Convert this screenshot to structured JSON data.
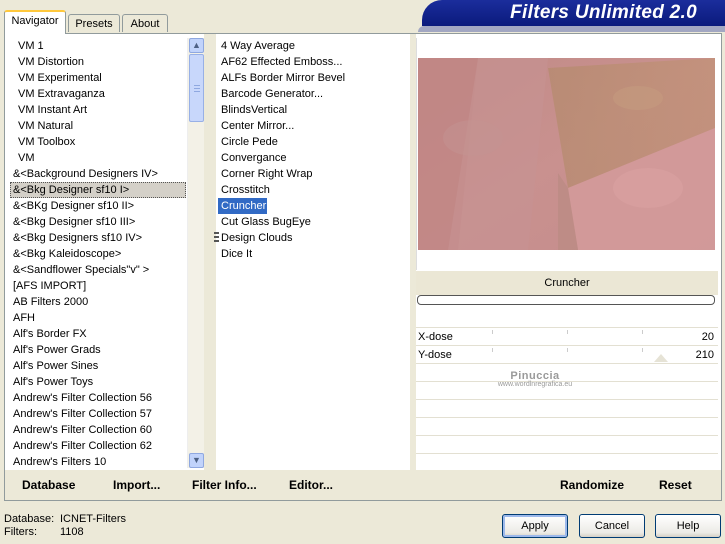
{
  "tabs": [
    {
      "label": "Navigator",
      "active": true
    },
    {
      "label": "Presets",
      "active": false
    },
    {
      "label": "About",
      "active": false
    }
  ],
  "banner_title": "Filters Unlimited 2.0",
  "categories": [
    "VM 1",
    "VM Distortion",
    "VM Experimental",
    "VM Extravaganza",
    "VM Instant Art",
    "VM Natural",
    "VM Toolbox",
    "VM",
    "&<Background Designers IV>",
    "&<Bkg Designer sf10 I>",
    "&<BKg Designer sf10 II>",
    "&<Bkg Designer sf10 III>",
    "&<Bkg Designers sf10 IV>",
    "&<Bkg Kaleidoscope>",
    "&<Sandflower Specials\"v\" >",
    "[AFS IMPORT]",
    "AB Filters 2000",
    "AFH",
    "Alf's Border FX",
    "Alf's Power Grads",
    "Alf's Power Sines",
    "Alf's Power Toys",
    "Andrew's Filter Collection 56",
    "Andrew's Filter Collection 57",
    "Andrew's Filter Collection 60",
    "Andrew's Filter Collection 62",
    "Andrew's Filters 10"
  ],
  "selected_category": "&<Bkg Designer sf10 I>",
  "filters": [
    "4 Way Average",
    "AF62 Effected Emboss...",
    "ALFs Border Mirror Bevel",
    "Barcode Generator...",
    "BlindsVertical",
    "Center Mirror...",
    "Circle Pede",
    "Convergance",
    "Corner Right Wrap",
    "Crosstitch",
    "Cruncher",
    "Cut Glass  BugEye",
    "Design Clouds",
    "Dice It"
  ],
  "selected_filter": "Cruncher",
  "preview": {
    "filter_name": "Cruncher",
    "colors": {
      "base": "#c58f8f",
      "light": "#d89a9a",
      "tan": "#b68f70"
    }
  },
  "params": [
    {
      "label": "X-dose",
      "value": "20"
    },
    {
      "label": "Y-dose",
      "value": "210"
    }
  ],
  "watermark": {
    "line1": "Pinuccia",
    "line2": "www.wordlnregrafica.eu"
  },
  "toolbar": {
    "database": "Database",
    "import": "Import...",
    "filter_info": "Filter Info...",
    "editor": "Editor...",
    "randomize": "Randomize",
    "reset": "Reset"
  },
  "status": {
    "database_label": "Database:",
    "database_value": "ICNET-Filters",
    "filters_label": "Filters:",
    "filters_value": "1108"
  },
  "buttons": {
    "apply": "Apply",
    "cancel": "Cancel",
    "help": "Help"
  },
  "scroll": {
    "up": "▲",
    "down": "▼"
  },
  "colors": {
    "accent": "#316ac5",
    "banner": "#1b2d9c"
  }
}
